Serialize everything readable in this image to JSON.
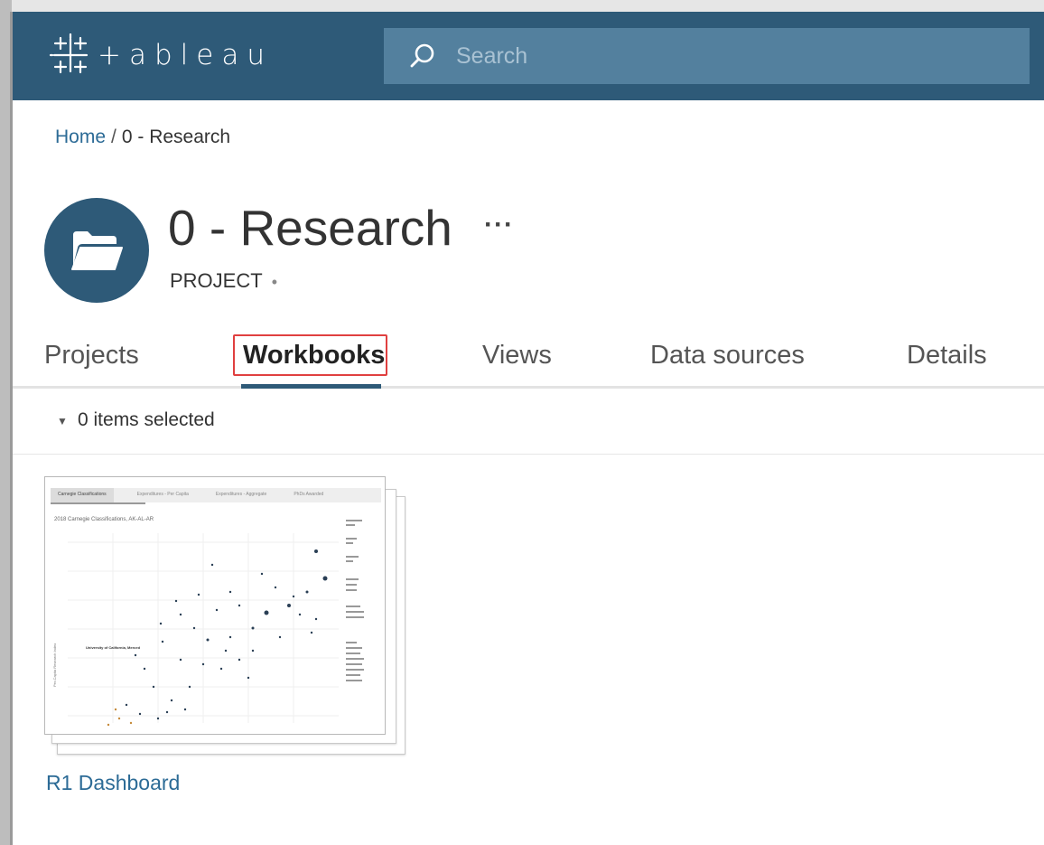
{
  "app": {
    "logo_text": "+ableau"
  },
  "search": {
    "placeholder": "Search"
  },
  "breadcrumb": {
    "home": "Home",
    "separator": "/",
    "current": "0 - Research"
  },
  "project": {
    "title": "0 - Research",
    "more": "···",
    "type": "PROJECT",
    "type_dot": "•"
  },
  "tabs": [
    {
      "label": "Projects",
      "active": false
    },
    {
      "label": "Workbooks",
      "active": true
    },
    {
      "label": "Views",
      "active": false
    },
    {
      "label": "Data sources",
      "active": false
    },
    {
      "label": "Details",
      "active": false
    }
  ],
  "selection": {
    "caret": "▼",
    "text": "0 items selected"
  },
  "workbook": {
    "title": "R1 Dashboard",
    "thumbnail": {
      "tabs": [
        "Carnegie Classifications",
        "Expenditures - Per Capita",
        "Expenditures - Aggregate",
        "PhDs Awarded"
      ],
      "chart_title": "2018 Carnegie Classifications, AK-AL-AR",
      "annotation": "University of California, Merced",
      "y_label": "Per-Capita Research Index"
    }
  },
  "colors": {
    "topbar": "#2e5a78",
    "search_bg": "#53809e",
    "link": "#2c6b96",
    "highlight": "#e04040"
  }
}
